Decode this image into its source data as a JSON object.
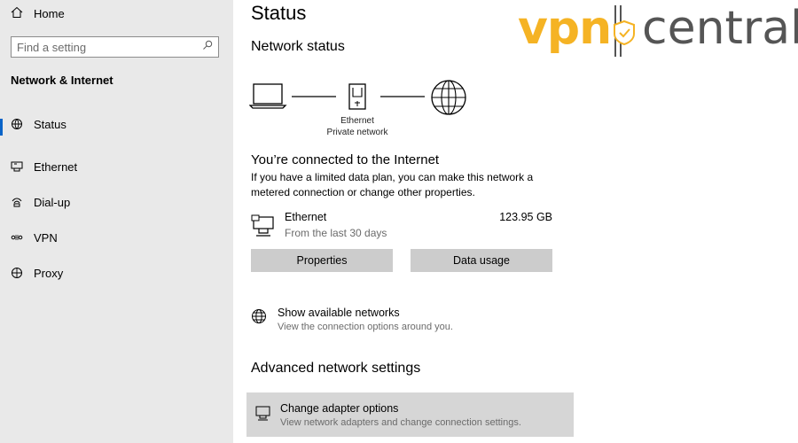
{
  "sidebar": {
    "home_label": "Home",
    "search_placeholder": "Find a setting",
    "section_title": "Network & Internet",
    "items": [
      {
        "label": "Status",
        "icon": "status-icon"
      },
      {
        "label": "Ethernet",
        "icon": "ethernet-icon"
      },
      {
        "label": "Dial-up",
        "icon": "dialup-icon"
      },
      {
        "label": "VPN",
        "icon": "vpn-icon"
      },
      {
        "label": "Proxy",
        "icon": "globe-icon"
      }
    ]
  },
  "main": {
    "title": "Status",
    "network_status": "Network status",
    "diagram": {
      "adapter": "Ethernet",
      "network_type": "Private network"
    },
    "connected_text": "You’re connected to the Internet",
    "description": "If you have a limited data plan, you can make this network a metered connection or change other properties.",
    "connection": {
      "name": "Ethernet",
      "period": "From the last 30 days",
      "usage": "123.95 GB"
    },
    "buttons": {
      "properties": "Properties",
      "data_usage": "Data usage"
    },
    "show_networks": {
      "label": "Show available networks",
      "sub": "View the connection options around you."
    },
    "advanced_title": "Advanced network settings",
    "adapter_options": {
      "label": "Change adapter options",
      "sub": "View network adapters and change connection settings."
    }
  },
  "logo": {
    "part1": "vpn",
    "part2": "central"
  },
  "colors": {
    "accent": "#0a64c8",
    "logo_orange": "#f5b324",
    "sidebar_bg": "#e9e9e9",
    "button_bg": "#cccccc"
  }
}
